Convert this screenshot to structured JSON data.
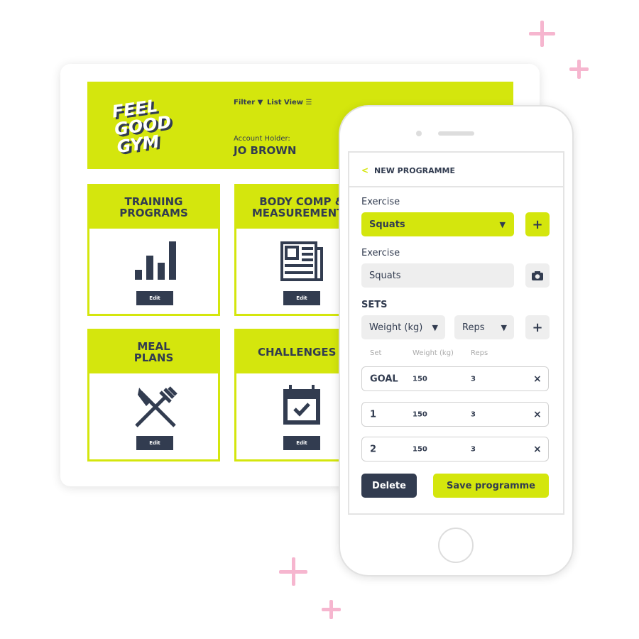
{
  "tablet": {
    "logo": [
      "FEEL",
      "GOOD",
      "GYM"
    ],
    "filter_label": "Filter ▼",
    "list_view_label": "List View",
    "account_label": "Account Holder:",
    "account_name": "JO BROWN",
    "tiles": [
      {
        "title": "TRAINING PROGRAMS",
        "icon": "bar-chart-icon",
        "edit": "Edit"
      },
      {
        "title": "BODY COMP & MEASUREMENTS",
        "icon": "newspaper-icon",
        "edit": "Edit"
      },
      {
        "title": "MEAL PLANS",
        "icon": "knife-fork-icon",
        "edit": "Edit"
      },
      {
        "title": "CHALLENGES",
        "icon": "calendar-check-icon",
        "edit": "Edit"
      }
    ]
  },
  "phone": {
    "back": "<",
    "title": "NEW PROGRAMME",
    "exercise_label": "Exercise",
    "exercise_select": "Squats",
    "exercise_label2": "Exercise",
    "exercise_input": "Squats",
    "sets_label": "SETS",
    "weight_select": "Weight (kg)",
    "reps_select": "Reps",
    "col_set": "Set",
    "col_weight": "Weight (kg)",
    "col_reps": "Reps",
    "rows": [
      {
        "set": "GOAL",
        "weight": "150",
        "reps": "3"
      },
      {
        "set": "1",
        "weight": "150",
        "reps": "3"
      },
      {
        "set": "2",
        "weight": "150",
        "reps": "3"
      }
    ],
    "delete": "Delete",
    "save": "Save programme"
  },
  "colors": {
    "accent": "#d4e60d",
    "navy": "#323c50",
    "pink": "#f6b6cf"
  }
}
